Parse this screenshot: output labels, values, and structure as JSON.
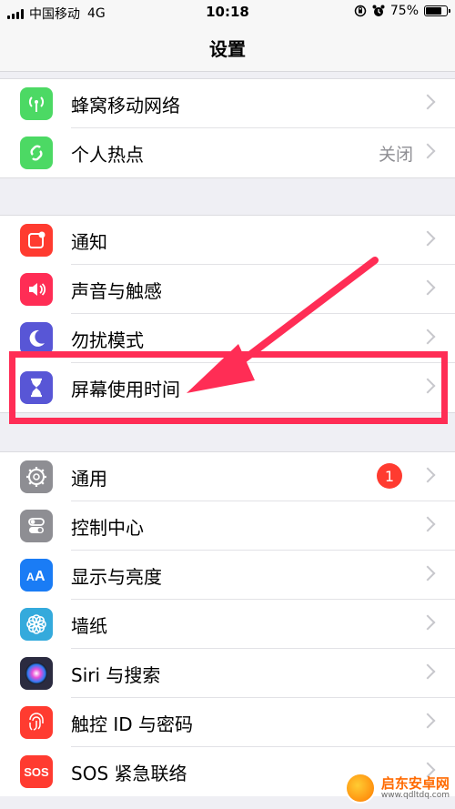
{
  "status_bar": {
    "carrier": "中国移动",
    "network": "4G",
    "time": "10:18",
    "battery": "75%"
  },
  "nav": {
    "title": "设置"
  },
  "groups": [
    [
      {
        "label": "蜂窝移动网络",
        "icon": "antenna-icon",
        "color": "#4cd964"
      },
      {
        "label": "个人热点",
        "icon": "hotspot-icon",
        "color": "#4cd964",
        "value": "关闭"
      }
    ],
    [
      {
        "label": "通知",
        "icon": "notification-icon",
        "color": "#ff3b30"
      },
      {
        "label": "声音与触感",
        "icon": "speaker-icon",
        "color": "#ff2d55"
      },
      {
        "label": "勿扰模式",
        "icon": "moon-icon",
        "color": "#5856d6"
      },
      {
        "label": "屏幕使用时间",
        "icon": "hourglass-icon",
        "color": "#5856d6"
      }
    ],
    [
      {
        "label": "通用",
        "icon": "gear-icon",
        "color": "#8e8e93",
        "badge": "1"
      },
      {
        "label": "控制中心",
        "icon": "switches-icon",
        "color": "#8e8e93"
      },
      {
        "label": "显示与亮度",
        "icon": "display-icon",
        "color": "#1a7cf5"
      },
      {
        "label": "墙纸",
        "icon": "flower-icon",
        "color": "#34aadc"
      },
      {
        "label": "Siri 与搜索",
        "icon": "siri-icon",
        "color": "#2b2b40"
      },
      {
        "label": "触控 ID 与密码",
        "icon": "fingerprint-icon",
        "color": "#ff3b30"
      },
      {
        "label": "SOS 紧急联络",
        "icon": "sos-icon",
        "color": "#ff3b30",
        "icon_text": "SOS"
      }
    ]
  ],
  "watermark": {
    "name": "启东安卓网",
    "url": "www.qdltdq.com"
  }
}
